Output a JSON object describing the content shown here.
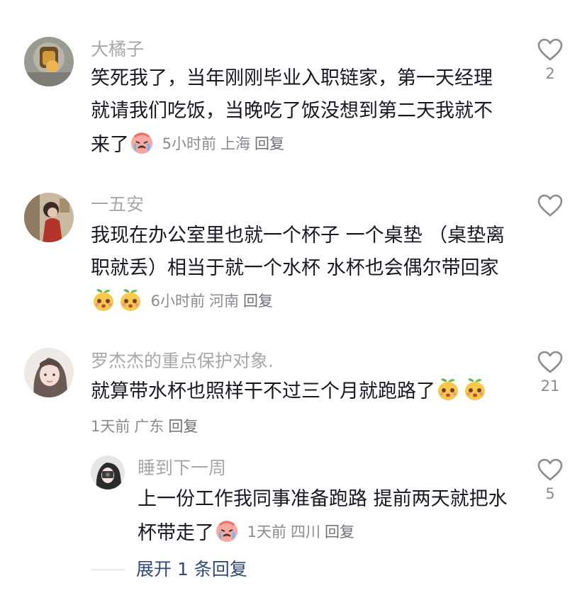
{
  "comments": [
    {
      "username": "大橘子",
      "text": "笑死我了，当年刚刚毕业入职链家，第一天经理就请我们吃饭，当晚吃了饭没想到第二天我就不来了",
      "emojis": [
        "crying-face-icon"
      ],
      "time": "5小时前",
      "location": "上海",
      "reply_label": "回复",
      "likes": "2"
    },
    {
      "username": "一五安",
      "text": "我现在办公室里也就一个杯子 一个桌垫 （桌垫离职就丢）相当于就一个水杯 水杯也会偶尔带回家",
      "emojis": [
        "mango-face-icon",
        "mango-face-icon"
      ],
      "time": "6小时前",
      "location": "河南",
      "reply_label": "回复",
      "likes": ""
    },
    {
      "username": "罗杰杰的重点保护对象.",
      "text": "就算带水杯也照样干不过三个月就跑路了",
      "emojis": [
        "mango-face-icon",
        "mango-face-icon"
      ],
      "time": "1天前",
      "location": "广东",
      "reply_label": "回复",
      "likes": "21"
    },
    {
      "username": "睡到下一周",
      "text": "上一份工作我同事准备跑路 提前两天就把水杯带走了",
      "emojis": [
        "crying-face-icon"
      ],
      "time": "1天前",
      "location": "四川",
      "reply_label": "回复",
      "likes": "5"
    }
  ],
  "expand_replies": "展开 1 条回复",
  "colors": {
    "username": "#a6a7ab",
    "text": "#161823",
    "meta": "#8a8b91",
    "expand": "#2f4a78"
  }
}
